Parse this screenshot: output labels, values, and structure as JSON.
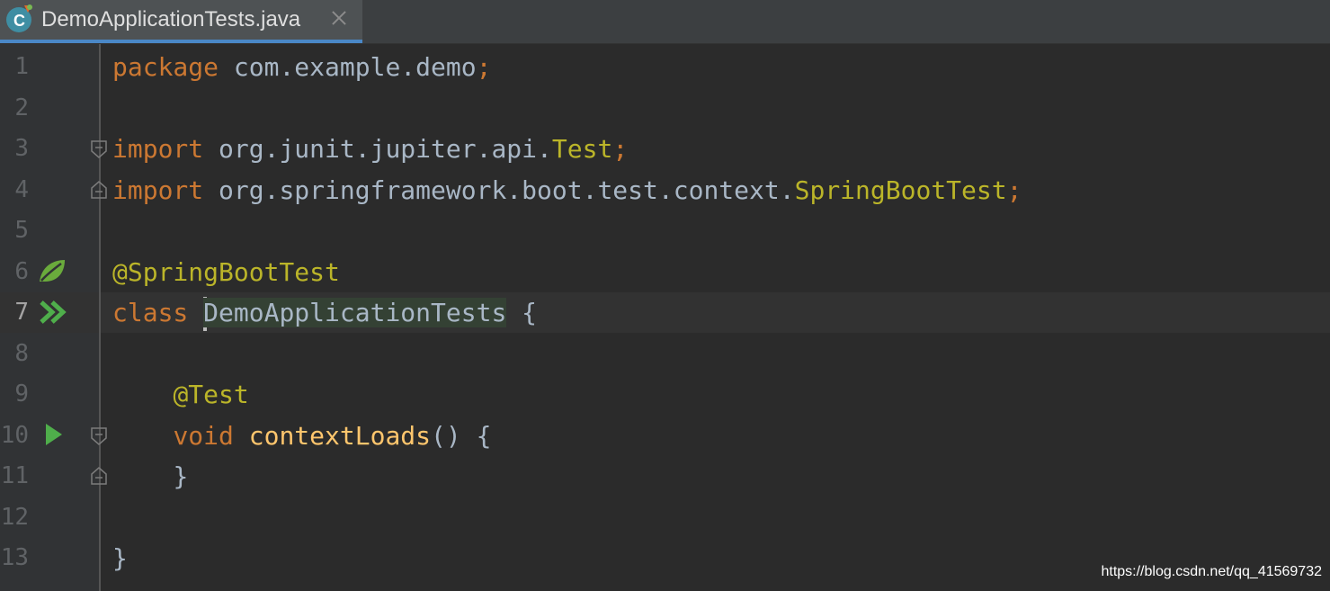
{
  "tab": {
    "title": "DemoApplicationTests.java",
    "file_icon": "java-class-c-icon",
    "close_icon": "close-icon"
  },
  "editor": {
    "line_numbers": [
      "1",
      "2",
      "3",
      "4",
      "5",
      "6",
      "7",
      "8",
      "9",
      "10",
      "11",
      "12",
      "13"
    ],
    "current_line": "7",
    "lines": {
      "l1": {
        "kw": "package",
        "rest": " com.example.demo",
        "semi": ";"
      },
      "l3": {
        "kw": "import",
        "pkg": " org.junit.jupiter.api.",
        "cls": "Test",
        "semi": ";"
      },
      "l4": {
        "kw": "import",
        "pkg": " org.springframework.boot.test.context.",
        "cls": "SpringBootTest",
        "semi": ";"
      },
      "l6": {
        "ann": "@SpringBootTest"
      },
      "l7": {
        "kw": "class",
        "sp": " ",
        "name": "DemoApplicationTests",
        "rest": " {"
      },
      "l9": {
        "indent": "    ",
        "ann": "@Test"
      },
      "l10": {
        "indent": "    ",
        "kw": "void",
        "sp": " ",
        "fn": "contextLoads",
        "rest": "() {"
      },
      "l11": {
        "indent": "    ",
        "rest": "}"
      },
      "l13": {
        "rest": "}"
      }
    },
    "gutter_icons": {
      "spring": "spring-leaf-icon",
      "run_class": "run-all-tests-icon",
      "run_method": "run-test-icon"
    },
    "colors": {
      "keyword": "#cc7832",
      "annotation": "#bbb529",
      "method": "#ffc66d",
      "text": "#a9b7c6",
      "background": "#2b2b2b"
    }
  },
  "watermark": "https://blog.csdn.net/qq_41569732"
}
